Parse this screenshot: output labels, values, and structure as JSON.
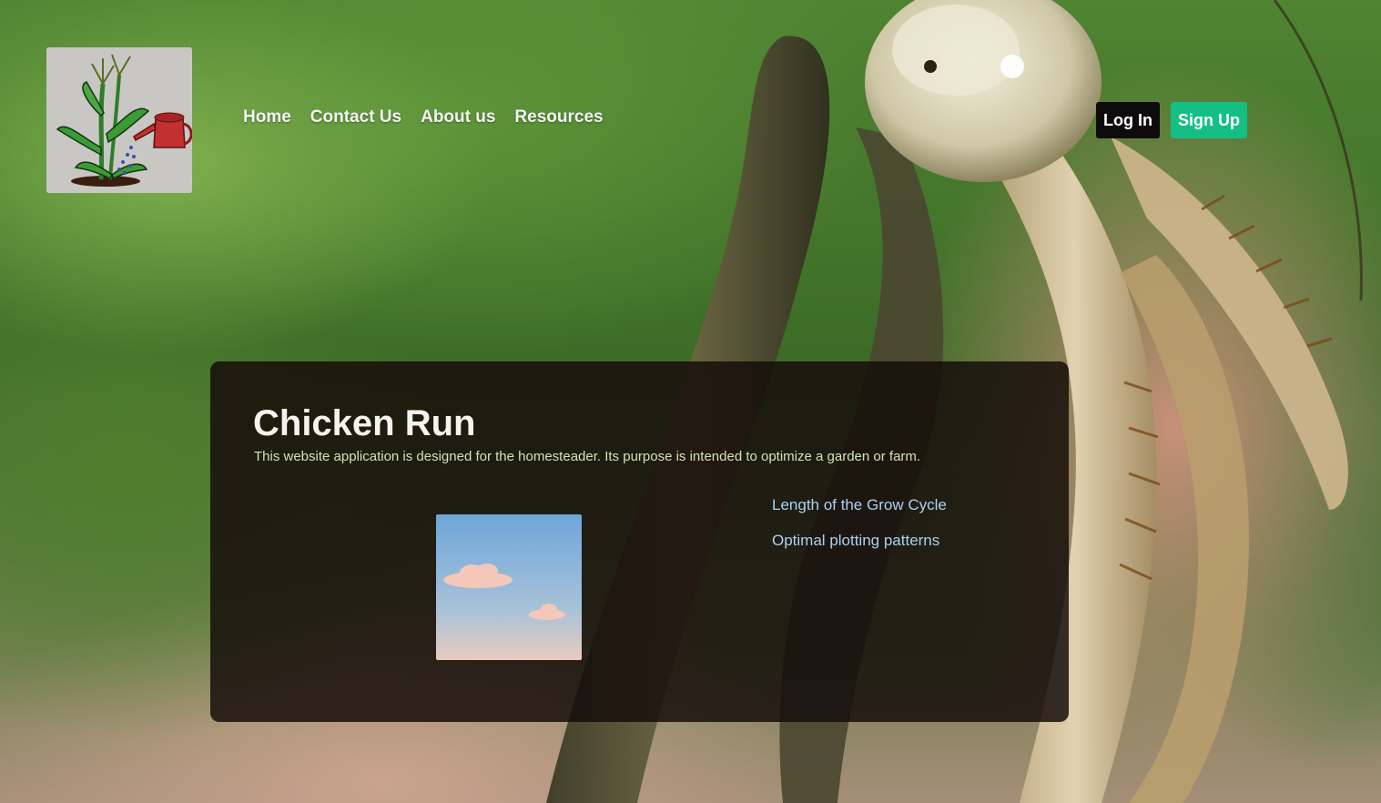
{
  "header": {
    "logo_icon": "plant-with-watering-can-icon",
    "nav": [
      {
        "label": "Home"
      },
      {
        "label": "Contact Us"
      },
      {
        "label": "About us"
      },
      {
        "label": "Resources"
      }
    ],
    "login_label": "Log In",
    "signup_label": "Sign Up"
  },
  "hero": {
    "title": "Chicken Run",
    "description": "This website application is designed for the homesteader. Its purpose is intended to optimize a garden or farm.",
    "image_icon": "sky-clouds-image",
    "features": [
      {
        "label": "Length of the Grow Cycle"
      },
      {
        "label": "Optimal plotting patterns"
      }
    ]
  },
  "colors": {
    "signup_button": "#14bf86",
    "login_button": "#0f0b0a",
    "card_background": "#140c09",
    "feature_link": "#a9d1f2",
    "description_text": "#d3e3b4"
  }
}
